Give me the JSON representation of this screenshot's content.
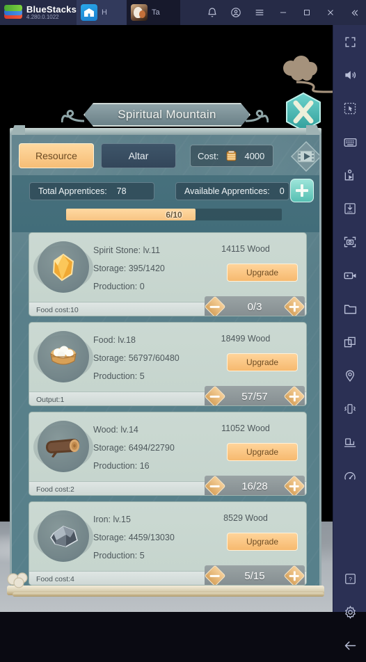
{
  "titlebar": {
    "app_name": "BlueStacks",
    "version": "4.280.0.1022",
    "tabs": [
      {
        "id": "home",
        "label": "H",
        "icon": "home-icon"
      },
      {
        "id": "game",
        "label": "Ta",
        "icon": "game-thumb-icon"
      }
    ],
    "controls": [
      {
        "name": "notification-bell-icon"
      },
      {
        "name": "account-icon"
      },
      {
        "name": "menu-icon"
      },
      {
        "name": "minimize-icon"
      },
      {
        "name": "maximize-icon"
      },
      {
        "name": "close-icon"
      },
      {
        "name": "collapse-sidebar-icon"
      }
    ]
  },
  "sidebar": {
    "items": [
      {
        "name": "fullscreen-icon"
      },
      {
        "name": "volume-icon"
      },
      {
        "name": "keymapping-pointer-icon"
      },
      {
        "name": "keyboard-icon"
      },
      {
        "name": "macro-play-icon"
      },
      {
        "name": "install-apk-icon"
      },
      {
        "name": "screenshot-icon"
      },
      {
        "name": "record-video-icon"
      },
      {
        "name": "media-folder-icon"
      },
      {
        "name": "multi-instance-icon"
      },
      {
        "name": "location-pin-icon"
      },
      {
        "name": "shake-device-icon"
      },
      {
        "name": "rotate-screen-icon"
      },
      {
        "name": "performance-gauge-icon"
      },
      {
        "name": "help-icon"
      },
      {
        "name": "settings-gear-icon"
      },
      {
        "name": "back-arrow-icon"
      }
    ]
  },
  "game": {
    "title": "Spiritual Mountain",
    "close_button": "close-hex-button",
    "video_badge": "video-ad-badge",
    "tabs": [
      {
        "id": "resource",
        "label": "Resource",
        "active": true
      },
      {
        "id": "altar",
        "label": "Altar",
        "active": false
      }
    ],
    "cost": {
      "label": "Cost:",
      "icon": "coin-stack-icon",
      "value": "4000"
    },
    "apprentices": {
      "total_label": "Total Apprentices:",
      "total_value": "78",
      "available_label": "Available Apprentices:",
      "available_value": "0",
      "add_button": "add-apprentice-button",
      "progress_text": "6/10",
      "progress_percent": 60
    },
    "resources": [
      {
        "icon": "spirit-stone-icon",
        "name_line": "Spirit Stone: lv.11",
        "storage_line": "Storage:  395/1420",
        "production_line": "Production:  0",
        "cost_text": "14115 Wood",
        "upgrade_label": "Upgrade",
        "foot_label": "Food cost:10",
        "stepper_value": "0/3"
      },
      {
        "icon": "food-basket-icon",
        "name_line": "Food: lv.18",
        "storage_line": "Storage:  56797/60480",
        "production_line": "Production:  5",
        "cost_text": "18499 Wood",
        "upgrade_label": "Upgrade",
        "foot_label": "Output:1",
        "stepper_value": "57/57"
      },
      {
        "icon": "wood-log-icon",
        "name_line": "Wood: lv.14",
        "storage_line": "Storage:  6494/22790",
        "production_line": "Production:  16",
        "cost_text": "11052 Wood",
        "upgrade_label": "Upgrade",
        "foot_label": "Food cost:2",
        "stepper_value": "16/28"
      },
      {
        "icon": "iron-ore-icon",
        "name_line": "Iron: lv.15",
        "storage_line": "Storage:  4459/13030",
        "production_line": "Production:  5",
        "cost_text": "8529 Wood",
        "upgrade_label": "Upgrade",
        "foot_label": "Food cost:4",
        "stepper_value": "5/15"
      }
    ]
  },
  "colors": {
    "titlebar_bg": "#262b47",
    "sidebar_bg": "#2b3054",
    "panel_bg": "#57808b",
    "accent_orange": "#f6bd76",
    "card_bg": "#c9d7d0",
    "teal_add": "#56bfb2"
  }
}
